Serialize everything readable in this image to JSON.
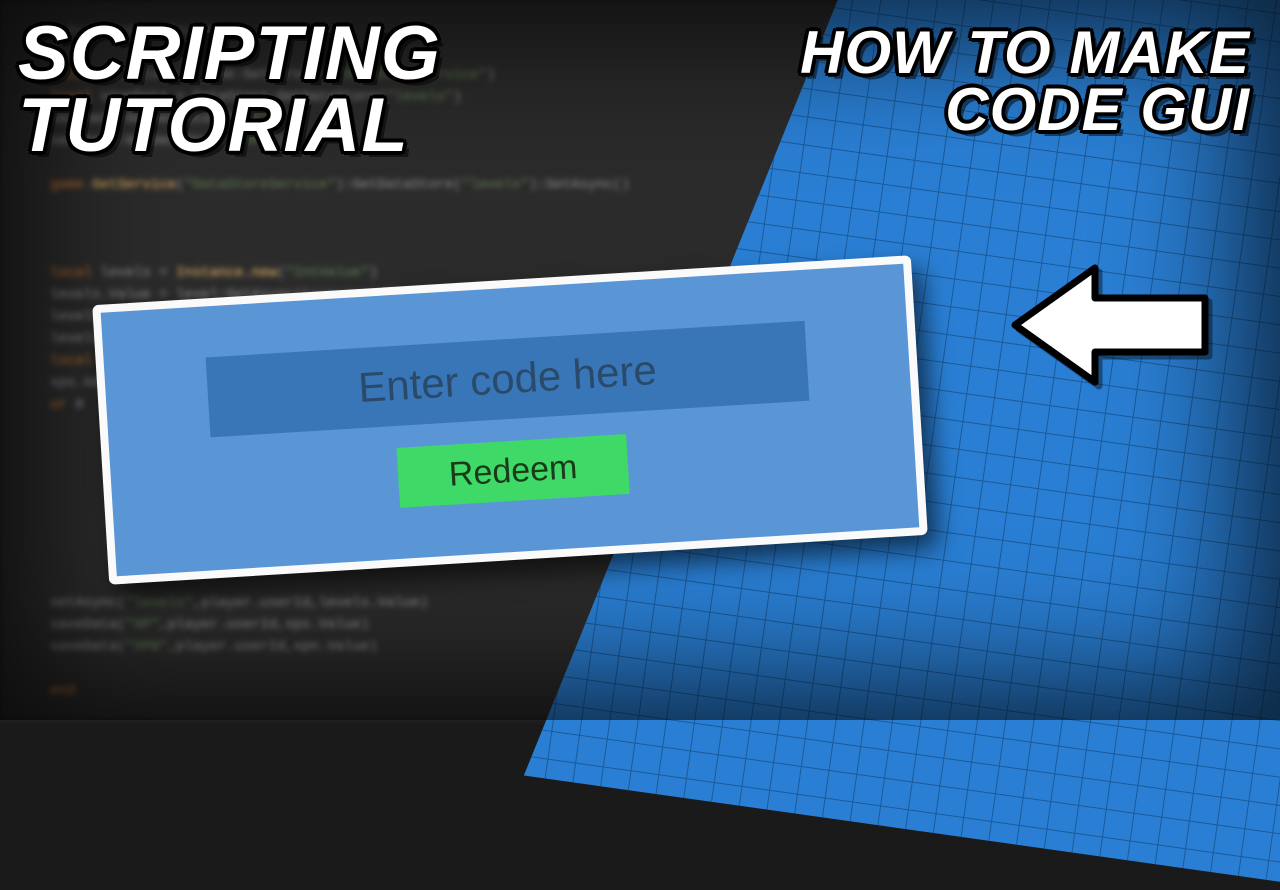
{
  "heading_left_line1": "SCRIPTING",
  "heading_left_line2": "TUTORIAL",
  "heading_right_line1": "HOW TO MAKE",
  "heading_right_line2": "CODE GUI",
  "gui": {
    "placeholder": "Enter code here",
    "redeem_label": "Redeem"
  },
  "arrow_icon": "arrow-left",
  "colors": {
    "panel_blue": "#2a7fd4",
    "card_blue": "#5a95d6",
    "input_blue": "#3976b8",
    "button_green": "#3fd968"
  }
}
